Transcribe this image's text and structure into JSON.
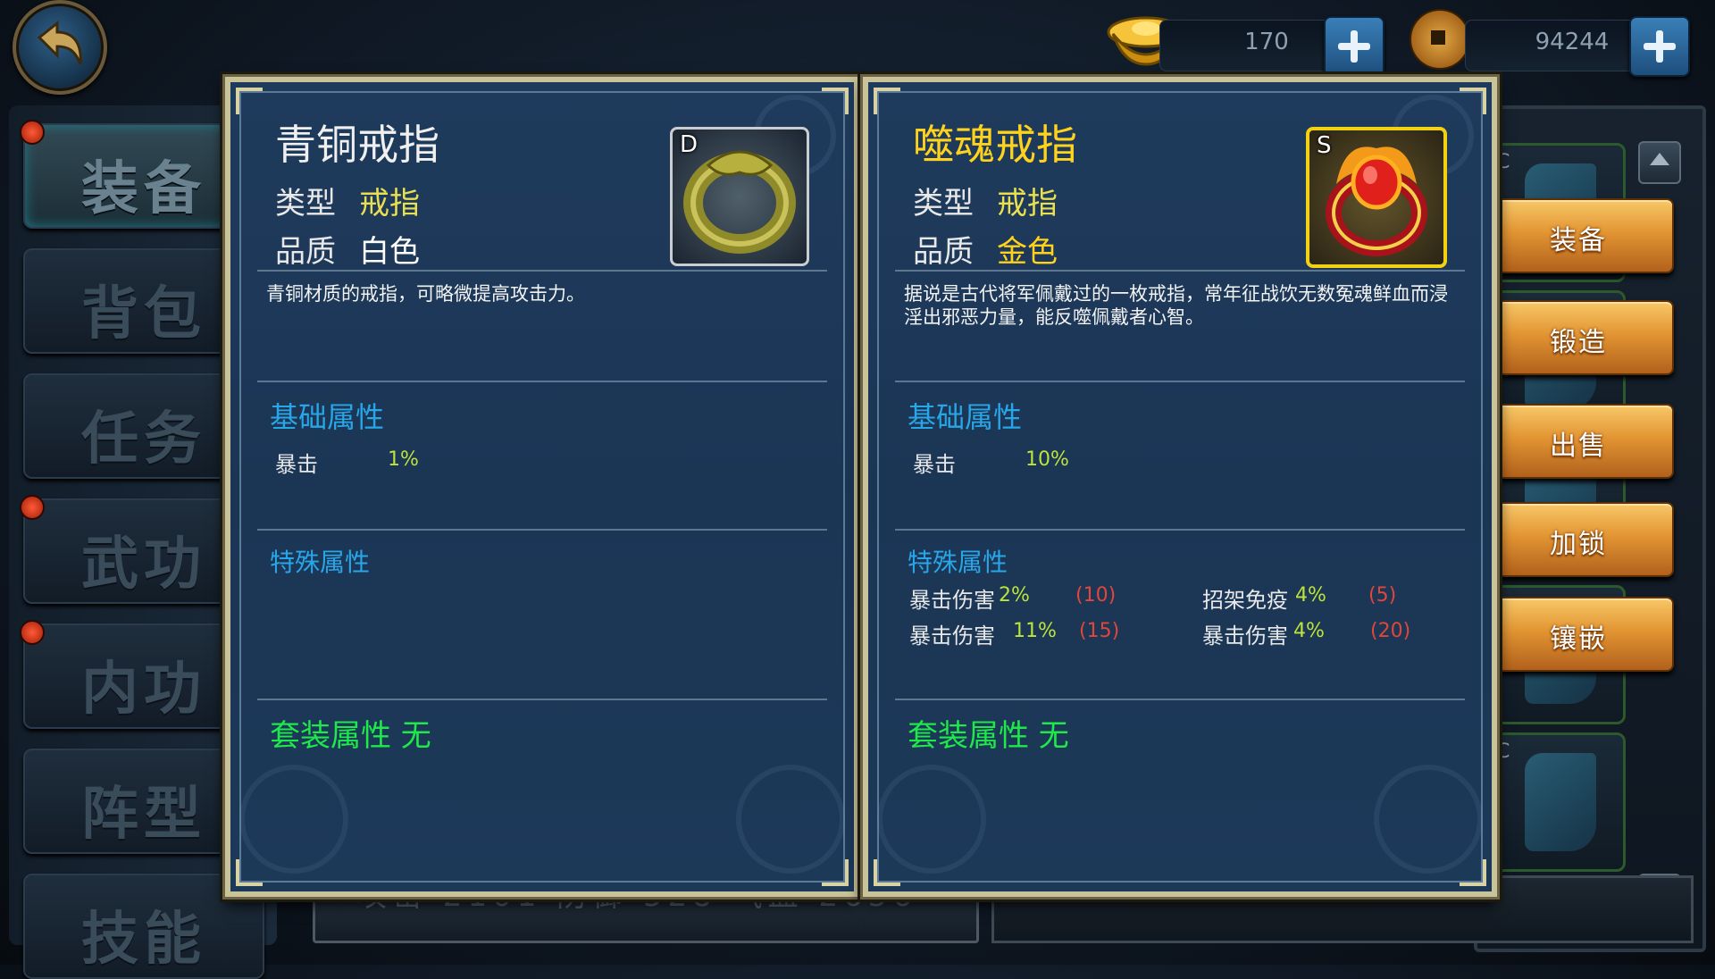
{
  "currency": {
    "ingot_value": "170",
    "coin_value": "94244",
    "icons": [
      "gold-ingot-icon",
      "copper-coin-icon",
      "plus-icon"
    ]
  },
  "nav": {
    "items": [
      {
        "label": "装备",
        "badge": true,
        "active": true
      },
      {
        "label": "背包",
        "badge": false,
        "active": false
      },
      {
        "label": "任务",
        "badge": false,
        "active": false
      },
      {
        "label": "武功",
        "badge": true,
        "active": false
      },
      {
        "label": "内功",
        "badge": true,
        "active": false
      },
      {
        "label": "阵型",
        "badge": false,
        "active": false
      },
      {
        "label": "技能",
        "badge": false,
        "active": false
      }
    ]
  },
  "actions": {
    "equip": "装备",
    "forge": "锻造",
    "sell": "出售",
    "lock": "加锁",
    "inlay": "镶嵌"
  },
  "stat_bar": {
    "text": "攻击 2101 防御 528 气血 2656"
  },
  "inventory": {
    "grade_letter": "C"
  },
  "cards": {
    "left": {
      "name": "青铜戒指",
      "grade": "D",
      "type_label": "类型",
      "type_value": "戒指",
      "quality_label": "品质",
      "quality_value": "白色",
      "description": "青铜材质的戒指，可略微提高攻击力。",
      "base_title": "基础属性",
      "base_stat_name": "暴击",
      "base_stat_value": "1%",
      "special_title": "特殊属性",
      "set_label": "套装属性 无"
    },
    "right": {
      "name": "噬魂戒指",
      "grade": "S",
      "type_label": "类型",
      "type_value": "戒指",
      "quality_label": "品质",
      "quality_value": "金色",
      "description": "据说是古代将军佩戴过的一枚戒指，常年征战饮无数冤魂鲜血而浸淫出邪恶力量，能反噬佩戴者心智。",
      "base_title": "基础属性",
      "base_stat_name": "暴击",
      "base_stat_value": "10%",
      "special_title": "特殊属性",
      "special_stats": [
        {
          "name": "暴击伤害",
          "pct": "2%",
          "num": "(10)"
        },
        {
          "name": "招架免疫",
          "pct": "4%",
          "num": "(5)"
        },
        {
          "name": "暴击伤害",
          "pct": "11%",
          "num": "(15)"
        },
        {
          "name": "暴击伤害",
          "pct": "4%",
          "num": "(20)"
        }
      ],
      "set_label": "套装属性 无"
    }
  },
  "colors": {
    "white_quality": "#ffffff",
    "gold_quality": "#ffd21e",
    "section_blue": "#28a6e8",
    "set_green": "#1ee84a",
    "pct_green": "#bde43a",
    "num_red": "#e0463a",
    "action_orange": "#e39533"
  }
}
